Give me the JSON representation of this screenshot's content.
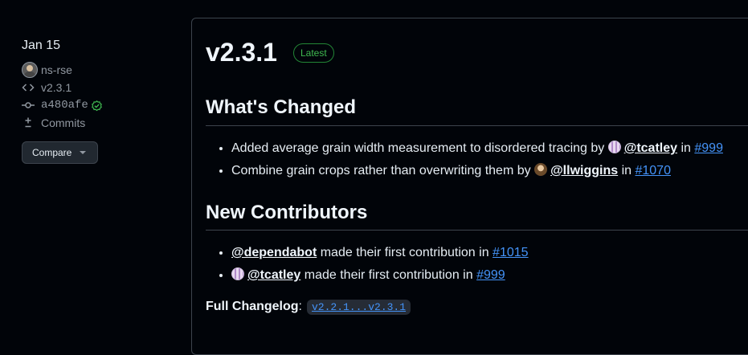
{
  "sidebar": {
    "date": "Jan 15",
    "author": "ns-rse",
    "tag": "v2.3.1",
    "commit": "a480afe",
    "commits_label": "Commits",
    "compare_label": "Compare",
    "icons": {
      "tag": "code-icon",
      "commit": "commit-icon",
      "commits": "diff-icon",
      "verified": "verified-check-icon"
    },
    "verified_color": "#3fb950"
  },
  "release": {
    "title": "v2.3.1",
    "badge": "Latest",
    "sections": {
      "changed": {
        "heading": "What's Changed",
        "items": [
          {
            "text": "Added average grain width measurement to disordered tracing by",
            "user": "@tcatley",
            "in": "in",
            "issue": "#999"
          },
          {
            "text": "Combine grain crops rather than overwriting them by",
            "user": "@llwiggins",
            "in": "in",
            "issue": "#1070"
          }
        ]
      },
      "contributors": {
        "heading": "New Contributors",
        "items": [
          {
            "user": "@dependabot",
            "text": "made their first contribution in",
            "issue": "#1015"
          },
          {
            "user": "@tcatley",
            "text": "made their first contribution in",
            "issue": "#999"
          }
        ]
      }
    },
    "changelog": {
      "label": "Full Changelog",
      "colon": ":",
      "range": "v2.2.1...v2.3.1"
    }
  },
  "colors": {
    "background": "#010409",
    "link": "#4493f8",
    "badge_green": "#3fb950",
    "border": "#3d444d"
  }
}
